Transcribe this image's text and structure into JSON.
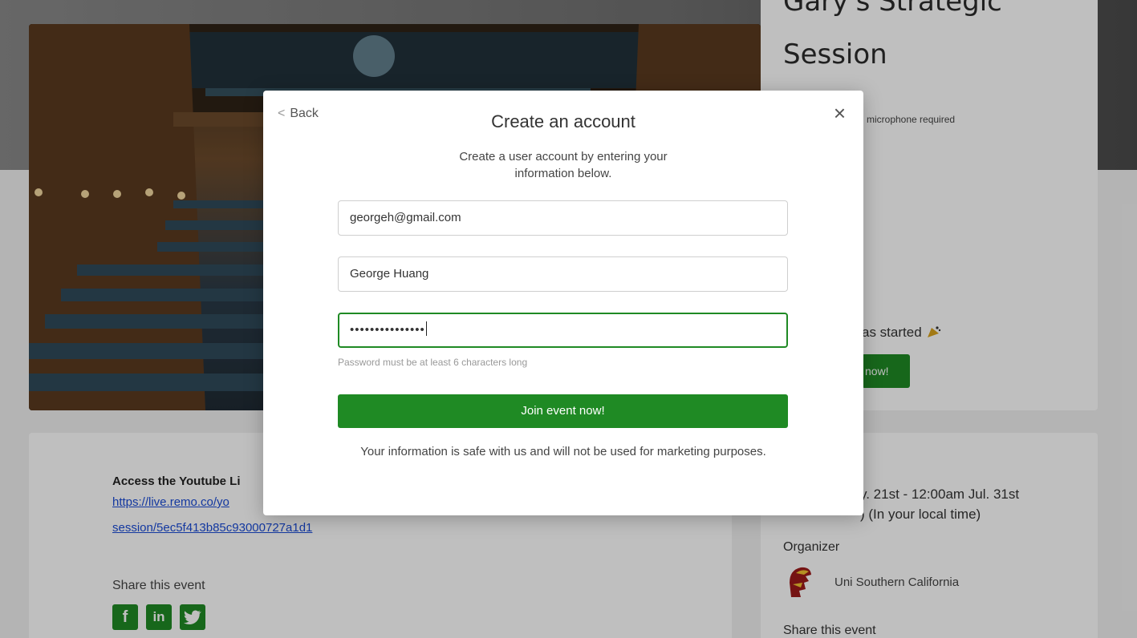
{
  "background": {
    "event_title_top": "Gary's Strategic",
    "event_title": "Session",
    "mic_text": "microphone required",
    "started_text": "as started",
    "started_button": "now!",
    "access_label": "Access the Youtube Li",
    "link_line1": "https://live.remo.co/yo",
    "link_line2": "session/5ec5f413b85c93000727a1d1",
    "share_label": "Share this event",
    "social": [
      "f",
      "in",
      "t"
    ],
    "date_line1": "y. 21st - 12:00am Jul. 31st",
    "date_line2": ") (In your local time)",
    "organizer_label": "Organizer",
    "organizer_name": "Uni Southern California",
    "share_label_2": "Share this event"
  },
  "modal": {
    "back_label": "Back",
    "close_label": "×",
    "title": "Create an account",
    "subtitle": "Create a user account by entering your information below.",
    "email_value": "georgeh@gmail.com",
    "name_value": "George Huang",
    "password_masked": "•••••••••••••••",
    "password_hint": "Password must be at least 6 characters long",
    "join_button": "Join event now!",
    "safe_text": "Your information is safe with us and will not be used for marketing purposes."
  },
  "colors": {
    "accent": "#1f8a24",
    "link": "#1a4bd6"
  }
}
